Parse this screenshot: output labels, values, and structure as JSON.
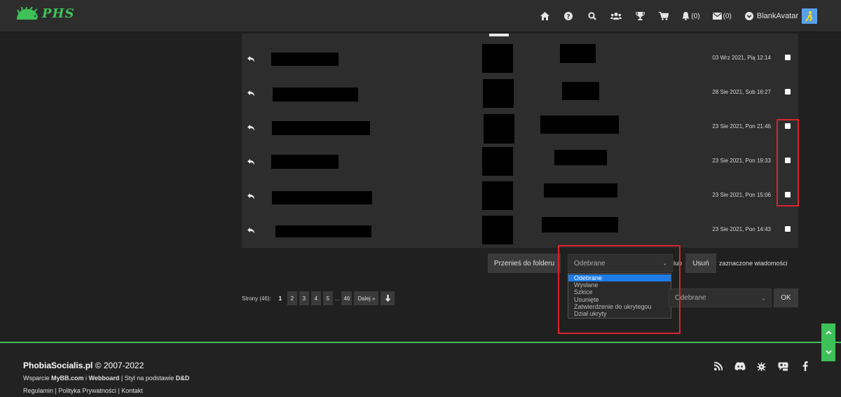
{
  "header": {
    "logo_text": "PHS",
    "notifications_count": "(0)",
    "messages_count": "(0)",
    "username": "BlankAvatar"
  },
  "messages": [
    {
      "date": "03 Wrz 2021, Pią 12:14"
    },
    {
      "date": "28 Sie 2021, Sob 16:27"
    },
    {
      "date": "23 Sie 2021, Pon 21:46"
    },
    {
      "date": "23 Sie 2021, Pon 19:33"
    },
    {
      "date": "23 Sie 2021, Pon 15:06"
    },
    {
      "date": "23 Sie 2021, Pon 14:43"
    }
  ],
  "actions": {
    "move_button": "Przenieś do folderu",
    "folder_select_value": "Odebrane",
    "or_text": "lub",
    "delete_button": "Usuń",
    "selected_text": "zaznaczone wiadomości",
    "folder_options": [
      "Odebrane",
      "Wysłane",
      "Szkice",
      "Usunięte",
      "Zatwierdzenie do ukrytegou",
      "Dział ukryty"
    ],
    "jump_select_value": "Odebrane",
    "ok_button": "OK"
  },
  "pagination": {
    "label": "Strony (46):",
    "pages": [
      "1",
      "2",
      "3",
      "4",
      "5"
    ],
    "dots": "...",
    "last": "46",
    "next": "Dalej »"
  },
  "footer": {
    "site": "PhobiaSocialis.pl",
    "years": " © 2007-2022",
    "support_prefix": "Wsparcie ",
    "mybb": "MyBB.com",
    "and": " i ",
    "webboard": "Webboard",
    "style_prefix": " | Styl na podstawie ",
    "style": "D&D",
    "links": [
      "Regulamin",
      "Polityka Prywatności",
      "Kontakt"
    ],
    "sep": " | "
  },
  "colors": {
    "accent": "#3fc15a",
    "highlight": "#d8242c",
    "selected_option": "#1e7ce8"
  }
}
